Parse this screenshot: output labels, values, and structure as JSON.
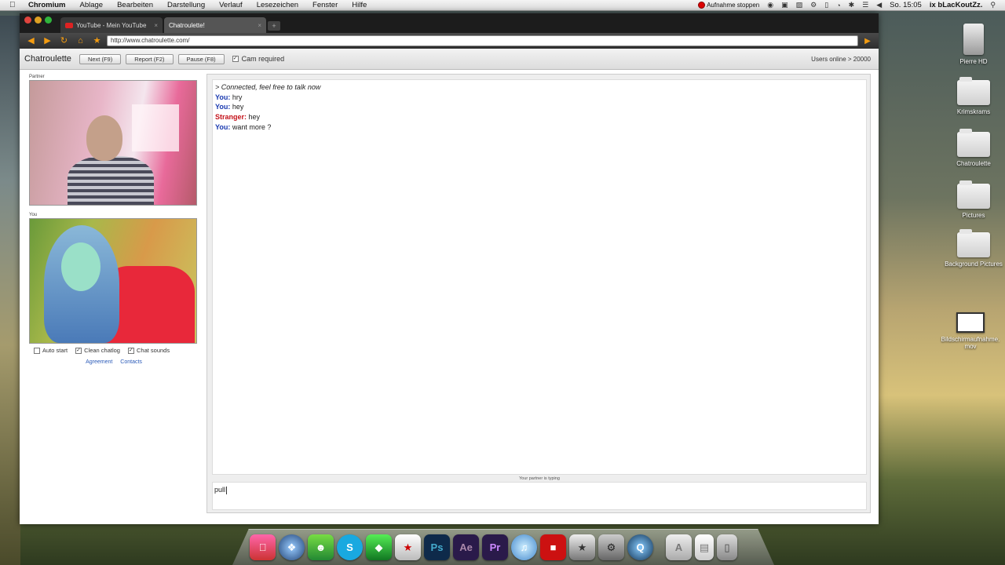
{
  "menubar": {
    "app_name": "Chromium",
    "items": [
      "Ablage",
      "Bearbeiten",
      "Darstellung",
      "Verlauf",
      "Lesezeichen",
      "Fenster",
      "Hilfe"
    ],
    "recording_label": "Aufnahme stoppen",
    "clock": "So. 15:05",
    "user": "ix bLacKoutZz."
  },
  "browser": {
    "tabs": [
      {
        "label": "YouTube - Mein YouTube"
      },
      {
        "label": "Chatroulette!"
      }
    ],
    "url": "http://www.chatroulette.com/"
  },
  "chatroulette": {
    "title": "Chatroulette",
    "buttons": {
      "next": "Next (F9)",
      "report": "Report (F2)",
      "pause": "Pause (F8)"
    },
    "cam_required_label": "Cam required",
    "users_online": "Users online > 20000",
    "partner_label": "Partner",
    "you_label": "You",
    "options": {
      "auto_start": "Auto start",
      "clean_chatlog": "Clean chatlog",
      "chat_sounds": "Chat sounds"
    },
    "links": {
      "agreement": "Agreement",
      "contacts": "Contacts"
    },
    "chat": {
      "system_message": "> Connected, feel free to talk now",
      "messages": [
        {
          "sender": "You:",
          "text": " hry"
        },
        {
          "sender": "You:",
          "text": " hey"
        },
        {
          "sender": "Stranger:",
          "text": " hey"
        },
        {
          "sender": "You:",
          "text": " want more ?"
        }
      ],
      "typing_status": "Your partner is typing",
      "input_value": "pull"
    }
  },
  "desktop": {
    "icons": [
      {
        "label": "Pierre HD"
      },
      {
        "label": "Krimskrams"
      },
      {
        "label": "Chatroulette"
      },
      {
        "label": "Pictures"
      },
      {
        "label": "Background Pictures"
      },
      {
        "label": "Bildschirmaufnahme.mov"
      }
    ]
  },
  "dock": {
    "icons": [
      "finder-icon",
      "safari-icon",
      "ichat-icon",
      "skype-icon",
      "sims-icon",
      "ical-icon",
      "photoshop-icon",
      "aftereffects-icon",
      "premiere-icon",
      "itunes-icon",
      "flashcam-icon",
      "imovie-icon",
      "preferences-icon",
      "quicktime-icon",
      "applications-icon",
      "documents-icon",
      "trash-icon"
    ],
    "labels": {
      "photoshop": "Ps",
      "aftereffects": "Ae",
      "premiere": "Pr"
    }
  }
}
